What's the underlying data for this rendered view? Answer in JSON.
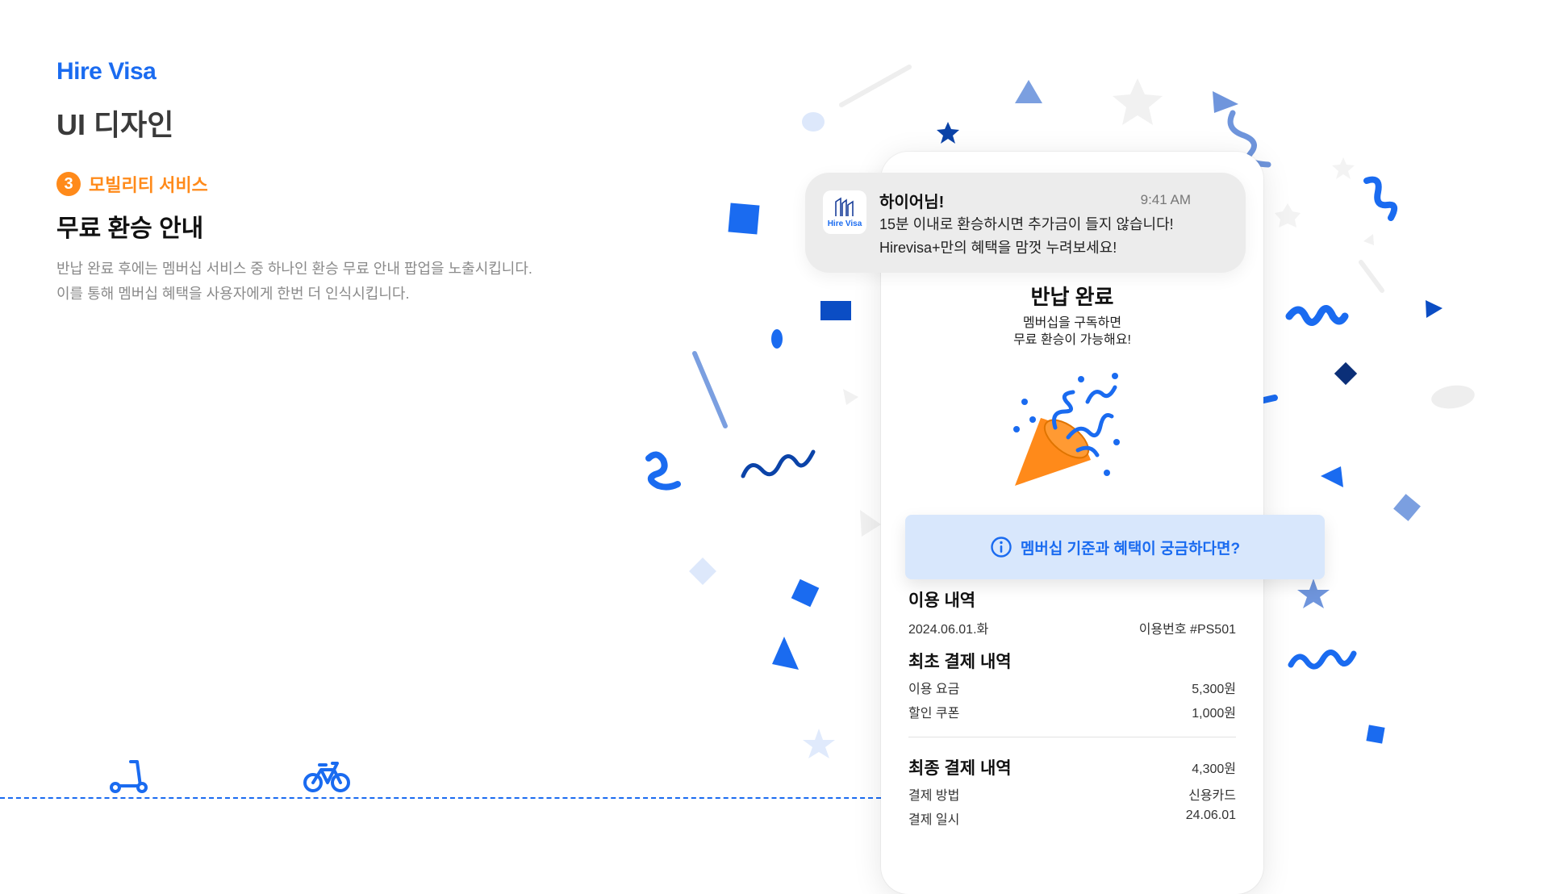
{
  "brand": {
    "logo": "Hire Visa"
  },
  "page": {
    "title": "UI 디자인"
  },
  "section": {
    "number": "3",
    "label": "모빌리티 서비스",
    "title": "무료 환승 안내",
    "desc_lines": [
      "반납 완료 후에는 멤버십 서비스 중 하나인 환승 무료 안내 팝업을 노출시킵니다.",
      "이를 통해 멤버십 혜택을 사용자에게 한번 더 인식시킵니다."
    ]
  },
  "notification": {
    "title": "하이어님!",
    "time": "9:41 AM",
    "logo_text": "Hire Visa",
    "lines": [
      "15분 이내로 환승하시면 추가금이 들지 않습니다!",
      "Hirevisa+만의 혜택을 맘껏 누려보세요!"
    ]
  },
  "popup": {
    "title": "반납 완료",
    "sub_lines": [
      "멤버십을 구독하면",
      "무료 환승이 가능해요!"
    ]
  },
  "banner": {
    "text": "멤버십 기준과 혜택이 궁금하다면?",
    "icon": "info-circle-icon"
  },
  "usage": {
    "heading": "이용 내역",
    "date": "2024.06.01.화",
    "usage_no": "이용번호 #PS501"
  },
  "initial_payment": {
    "heading": "최초 결제 내역",
    "rows": [
      {
        "label": "이용 요금",
        "value": "5,300원"
      },
      {
        "label": "할인 쿠폰",
        "value": "1,000원"
      }
    ]
  },
  "final_payment": {
    "heading": "최종 결제 내역",
    "total": "4,300원",
    "rows": [
      {
        "label": "결제 방법",
        "value": "신용카드"
      },
      {
        "label": "결제 일시",
        "value": "24.06.01"
      }
    ]
  },
  "icons": [
    "kick-scooter-icon",
    "bicycle-icon",
    "party-popper-icon",
    "info-circle-icon"
  ],
  "colors": {
    "accent": "#1a6bf0",
    "orange": "#ff8a1a",
    "banner_bg": "#d8e7fc",
    "popper": "#ff8a1a"
  }
}
